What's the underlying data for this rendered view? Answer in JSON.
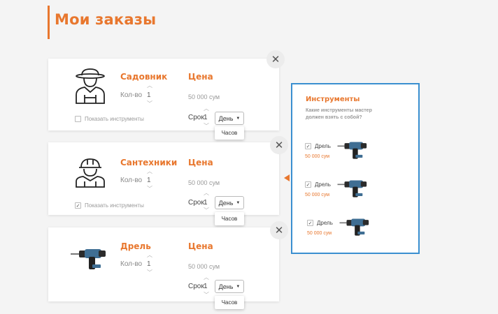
{
  "page": {
    "title": "Мои заказы"
  },
  "orders": [
    {
      "name": "Садовник",
      "price_label": "Цена",
      "qty_label": "Кол-во",
      "qty": "1",
      "price": "50 000 сум",
      "term_label": "Срок",
      "term_value": "1",
      "unit": "День",
      "unit_option": "Часов",
      "show_tools_label": "Показать инструменты",
      "show_tools_checked": false,
      "icon": "gardener-icon"
    },
    {
      "name": "Сантехники",
      "price_label": "Цена",
      "qty_label": "Кол-во",
      "qty": "1",
      "price": "50 000 сум",
      "term_label": "Срок",
      "term_value": "1",
      "unit": "День",
      "unit_option": "Часов",
      "show_tools_label": "Показать инструменты",
      "show_tools_checked": true,
      "icon": "plumber-icon"
    },
    {
      "name": "Дрель",
      "price_label": "Цена",
      "qty_label": "Кол-во",
      "qty": "1",
      "price": "50 000 сум",
      "term_label": "Срок",
      "term_value": "1",
      "unit": "День",
      "unit_option": "Часов",
      "icon": "drill-icon"
    }
  ],
  "tools_panel": {
    "title": "Инструменты",
    "subtitle": "Какие инструменты мастер должен взять с собой?",
    "items": [
      {
        "name": "Дрель",
        "price": "50 000 сум",
        "checked": true
      },
      {
        "name": "Дрель",
        "price": "50 000 сум",
        "checked": true
      },
      {
        "name": "Дрель",
        "price": "50 000 сум",
        "checked": true
      }
    ]
  },
  "colors": {
    "accent": "#e8772e",
    "panel_border": "#3a8fd0",
    "background": "#f4f4f4"
  }
}
